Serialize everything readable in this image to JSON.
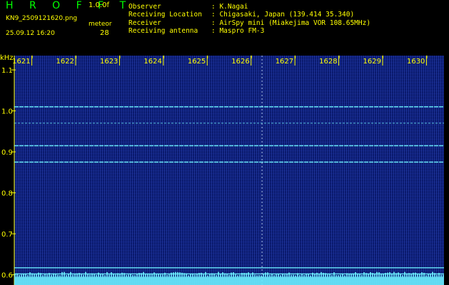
{
  "header": {
    "app_title": "H R O F F T",
    "version": "1.0.0f",
    "filename": "KN9_2509121620.png",
    "meteor_label": "meteor",
    "datetime": "25.09.12 16:20",
    "meteor_count": "28",
    "info": [
      {
        "label": "Observer",
        "value": ": K.Nagai"
      },
      {
        "label": "Receiving Location",
        "value": ": Chigasaki, Japan (139.414 35.340)"
      },
      {
        "label": "Receiver",
        "value": ": AirSpy mini (Miakejima VOR 108.65MHz)"
      },
      {
        "label": "Receiving antenna",
        "value": ": Maspro FM-3"
      }
    ]
  },
  "colors": {
    "background": "#0a1a6e",
    "label": "#ffff00",
    "title": "#00ff00",
    "signal": "#6cf0ff"
  },
  "chart_data": {
    "type": "heatmap",
    "ylabel": "kHz",
    "x_ticks": [
      "1621",
      "1622",
      "1623",
      "1624",
      "1625",
      "1626",
      "1627",
      "1628",
      "1629",
      "1630"
    ],
    "x_range": [
      1620.6,
      1630.4
    ],
    "y_ticks": [
      "1.1",
      "1.0",
      "0.9",
      "0.8",
      "0.7",
      "0.6"
    ],
    "y_range": [
      0.575,
      1.135
    ],
    "horizontal_lines_khz": [
      1.01,
      0.97,
      0.915,
      0.875,
      0.617,
      0.602
    ],
    "meteor_time": 1626.25
  }
}
